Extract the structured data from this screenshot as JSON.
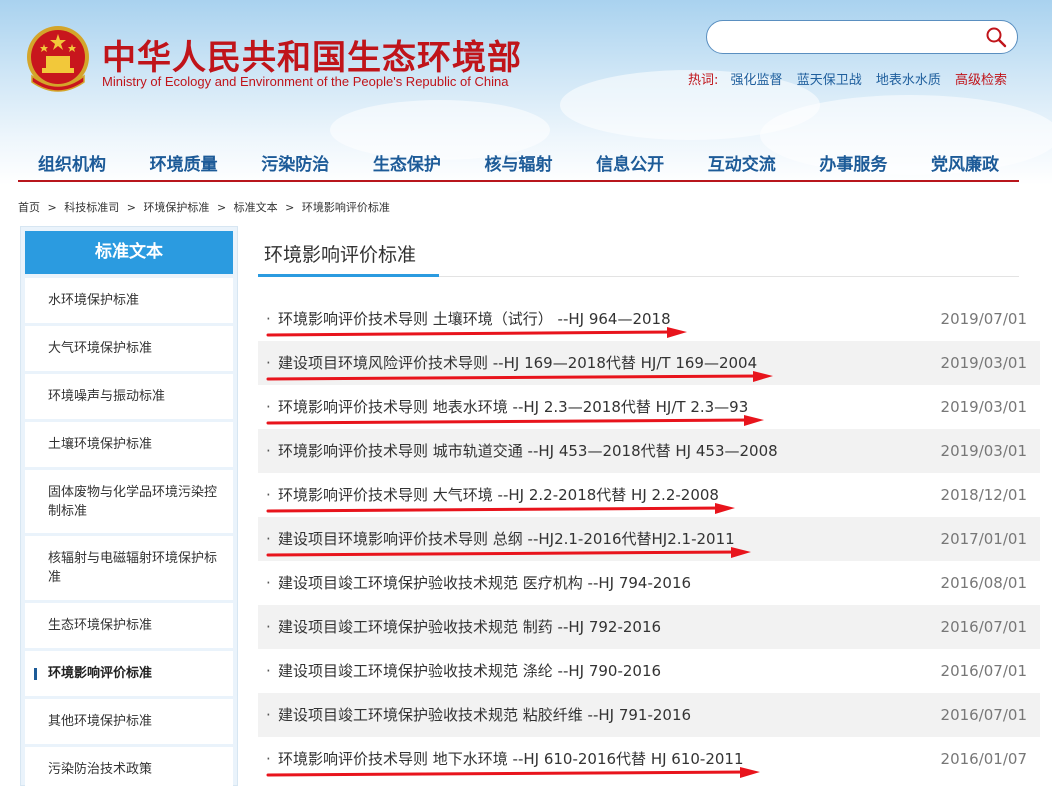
{
  "header": {
    "title": "中华人民共和国生态环境部",
    "subtitle": "Ministry of Ecology and Environment of the People's Republic of China",
    "search": {
      "value": "",
      "placeholder": ""
    },
    "hotwords_label": "热词:",
    "hotwords": [
      "强化监督",
      "蓝天保卫战",
      "地表水水质"
    ],
    "advanced_search": "高级检索"
  },
  "nav": [
    "组织机构",
    "环境质量",
    "污染防治",
    "生态保护",
    "核与辐射",
    "信息公开",
    "互动交流",
    "办事服务",
    "党风廉政"
  ],
  "breadcrumb": [
    "首页",
    "科技标准司",
    "环境保护标准",
    "标准文本",
    "环境影响评价标准"
  ],
  "breadcrumb_sep": ">",
  "sidebar": {
    "heading": "标准文本",
    "items": [
      "水环境保护标准",
      "大气环境保护标准",
      "环境噪声与振动标准",
      "土壤环境保护标准",
      "固体废物与化学品环境污染控制标准",
      "核辐射与电磁辐射环境保护标准",
      "生态环境保护标准",
      "环境影响评价标准",
      "其他环境保护标准",
      "污染防治技术政策"
    ],
    "active_index": 7
  },
  "content": {
    "title": "环境影响评价标准",
    "bullet": "·",
    "rows": [
      {
        "text": "环境影响评价技术导则 土壤环境（试行） --HJ 964—2018",
        "date": "2019/07/01",
        "marked": true
      },
      {
        "text": "建设项目环境风险评价技术导则 --HJ 169—2018代替 HJ/T 169—2004",
        "date": "2019/03/01",
        "marked": true
      },
      {
        "text": "环境影响评价技术导则 地表水环境 --HJ 2.3—2018代替 HJ/T 2.3—93",
        "date": "2019/03/01",
        "marked": true
      },
      {
        "text": "环境影响评价技术导则 城市轨道交通 --HJ 453—2018代替 HJ 453—2008",
        "date": "2019/03/01",
        "marked": false
      },
      {
        "text": "环境影响评价技术导则 大气环境 --HJ 2.2-2018代替 HJ 2.2-2008",
        "date": "2018/12/01",
        "marked": true
      },
      {
        "text": "建设项目环境影响评价技术导则 总纲 --HJ2.1-2016代替HJ2.1-2011",
        "date": "2017/01/01",
        "marked": true
      },
      {
        "text": "建设项目竣工环境保护验收技术规范 医疗机构 --HJ 794-2016",
        "date": "2016/08/01",
        "marked": false
      },
      {
        "text": "建设项目竣工环境保护验收技术规范 制药 --HJ 792-2016",
        "date": "2016/07/01",
        "marked": false
      },
      {
        "text": "建设项目竣工环境保护验收技术规范 涤纶 --HJ 790-2016",
        "date": "2016/07/01",
        "marked": false
      },
      {
        "text": "建设项目竣工环境保护验收技术规范 粘胶纤维 --HJ 791-2016",
        "date": "2016/07/01",
        "marked": false
      },
      {
        "text": "环境影响评价技术导则 地下水环境 --HJ 610-2016代替 HJ 610-2011",
        "date": "2016/01/07",
        "marked": true
      }
    ]
  },
  "colors": {
    "brand_red": "#c0141a",
    "nav_blue": "#1d5b98",
    "accent_blue": "#2b9be0",
    "annotation_red": "#e8141c"
  }
}
